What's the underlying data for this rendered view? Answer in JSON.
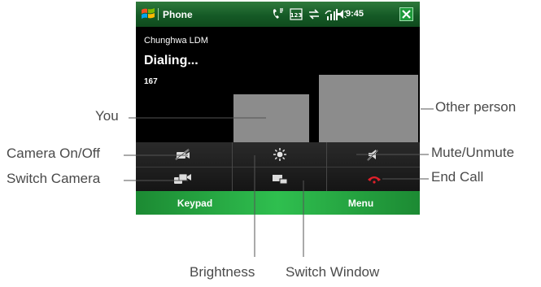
{
  "status_bar": {
    "start_icon": "windows-flag-icon",
    "app_title": "Phone",
    "icons": [
      "call-status-icon",
      "keyboard-123-icon",
      "data-connection-icon",
      "signal-strength-icon",
      "volume-icon"
    ],
    "time": "9:45",
    "close_icon": "close-icon"
  },
  "call": {
    "carrier": "Chunghwa LDM",
    "status": "Dialing...",
    "number": "167"
  },
  "controls": [
    {
      "icon": "camera-off-icon"
    },
    {
      "icon": "brightness-icon"
    },
    {
      "icon": "mute-speaker-icon"
    },
    {
      "icon": "switch-camera-icon"
    },
    {
      "icon": "switch-window-icon"
    },
    {
      "icon": "end-call-icon",
      "color": "#e0202a"
    }
  ],
  "softkeys": {
    "left": "Keypad",
    "right": "Menu"
  },
  "callouts": {
    "you": "You",
    "other_person": "Other person",
    "camera_on_off": "Camera On/Off",
    "mute_unmute": "Mute/Unmute",
    "switch_camera": "Switch Camera",
    "end_call": "End Call",
    "brightness": "Brightness",
    "switch_window": "Switch Window"
  },
  "colors": {
    "status_bar_green": "#155a26",
    "softkey_green": "#2fbf4f",
    "video_placeholder": "#8c8c8c",
    "end_call_red": "#e0202a"
  }
}
